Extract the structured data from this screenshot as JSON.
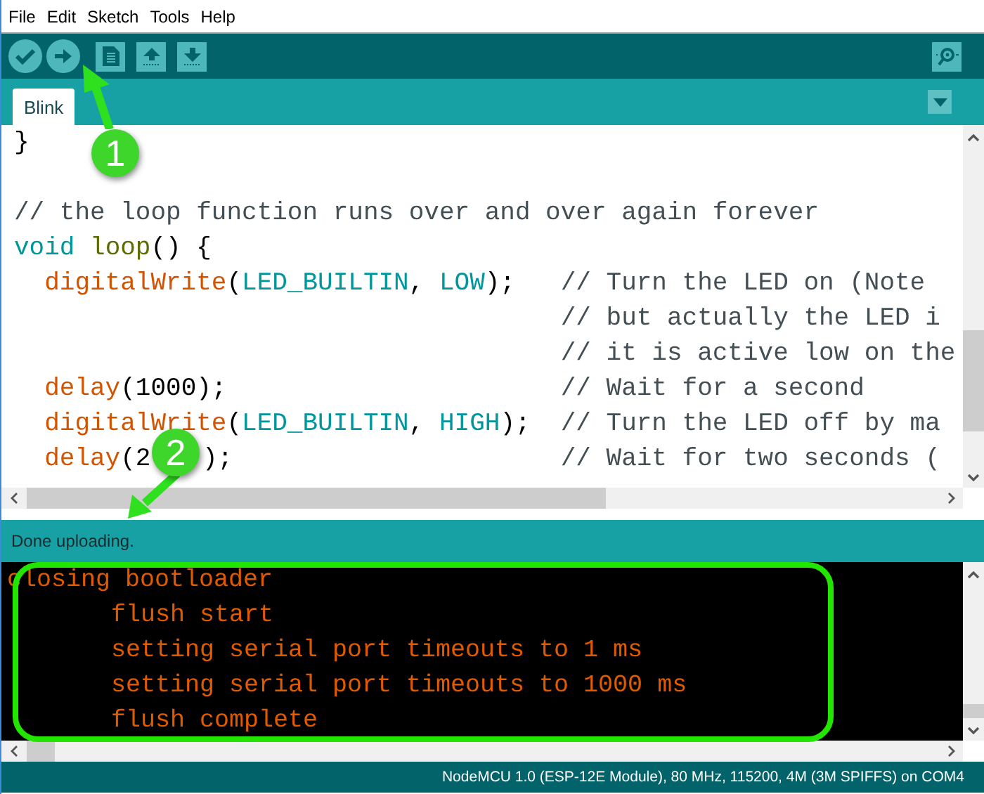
{
  "menu": [
    "File",
    "Edit",
    "Sketch",
    "Tools",
    "Help"
  ],
  "tabs": [
    {
      "label": "Blink",
      "selected": true
    }
  ],
  "editor": {
    "lines": [
      {
        "kind": "code",
        "indent": false,
        "tokens": [
          {
            "t": "}",
            "kind": "plain"
          }
        ]
      },
      {
        "kind": "blank"
      },
      {
        "kind": "code",
        "indent": false,
        "tokens": [
          {
            "t": "// the loop function runs over and over again forever",
            "kind": "comment"
          }
        ]
      },
      {
        "kind": "code",
        "indent": false,
        "tokens": [
          {
            "t": "void",
            "kind": "keyword"
          },
          {
            "t": "loop",
            "kind": "name-spaced"
          },
          {
            "t": "() {",
            "kind": "plain"
          }
        ]
      },
      {
        "kind": "code",
        "indent": true,
        "tokens": [
          {
            "t": "digitalWrite",
            "kind": "fn"
          },
          {
            "t": "(",
            "kind": "plain"
          },
          {
            "t": "LED_BUILTIN",
            "kind": "const"
          },
          {
            "t": ",",
            "kind": "plain"
          },
          {
            "t": "LOW",
            "kind": "const-spaced"
          },
          {
            "t": ");",
            "kind": "plain"
          }
        ],
        "comment": "// Turn the LED on (Note"
      },
      {
        "kind": "code",
        "comment": "// but actually the LED i"
      },
      {
        "kind": "code",
        "comment": "// it is active low on the"
      },
      {
        "kind": "code",
        "indent": true,
        "tokens": [
          {
            "t": "delay",
            "kind": "fn"
          },
          {
            "t": "(1000);",
            "kind": "plain"
          }
        ],
        "comment": "// Wait for a second"
      },
      {
        "kind": "code",
        "indent": true,
        "tokens": [
          {
            "t": "digitalWrite",
            "kind": "fn"
          },
          {
            "t": "(",
            "kind": "plain"
          },
          {
            "t": "LED_BUILTIN",
            "kind": "const"
          },
          {
            "t": ",",
            "kind": "plain"
          },
          {
            "t": "HIGH",
            "kind": "const-spaced"
          },
          {
            "t": ");",
            "kind": "plain"
          }
        ],
        "comment": "// Turn the LED off by ma"
      },
      {
        "kind": "code",
        "indent": true,
        "tokens": [
          {
            "t": "delay",
            "kind": "fn"
          },
          {
            "t": "(2",
            "kind": "plain"
          },
          {
            "t": ");",
            "kind": "after-cover"
          }
        ],
        "comment": "// Wait for two seconds ("
      }
    ]
  },
  "status": "Done uploading.",
  "console": [
    {
      "text": "closing bootloader",
      "indent": false
    },
    {
      "text": "flush start",
      "indent": true
    },
    {
      "text": "setting serial port timeouts to 1 ms",
      "indent": true
    },
    {
      "text": "setting serial port timeouts to 1000 ms",
      "indent": true
    },
    {
      "text": "flush complete",
      "indent": true
    }
  ],
  "board_info": "NodeMCU 1.0 (ESP-12E Module), 80 MHz, 115200, 4M (3M SPIFFS) on COM4",
  "annotations": [
    {
      "label": "1"
    },
    {
      "label": "2"
    }
  ]
}
